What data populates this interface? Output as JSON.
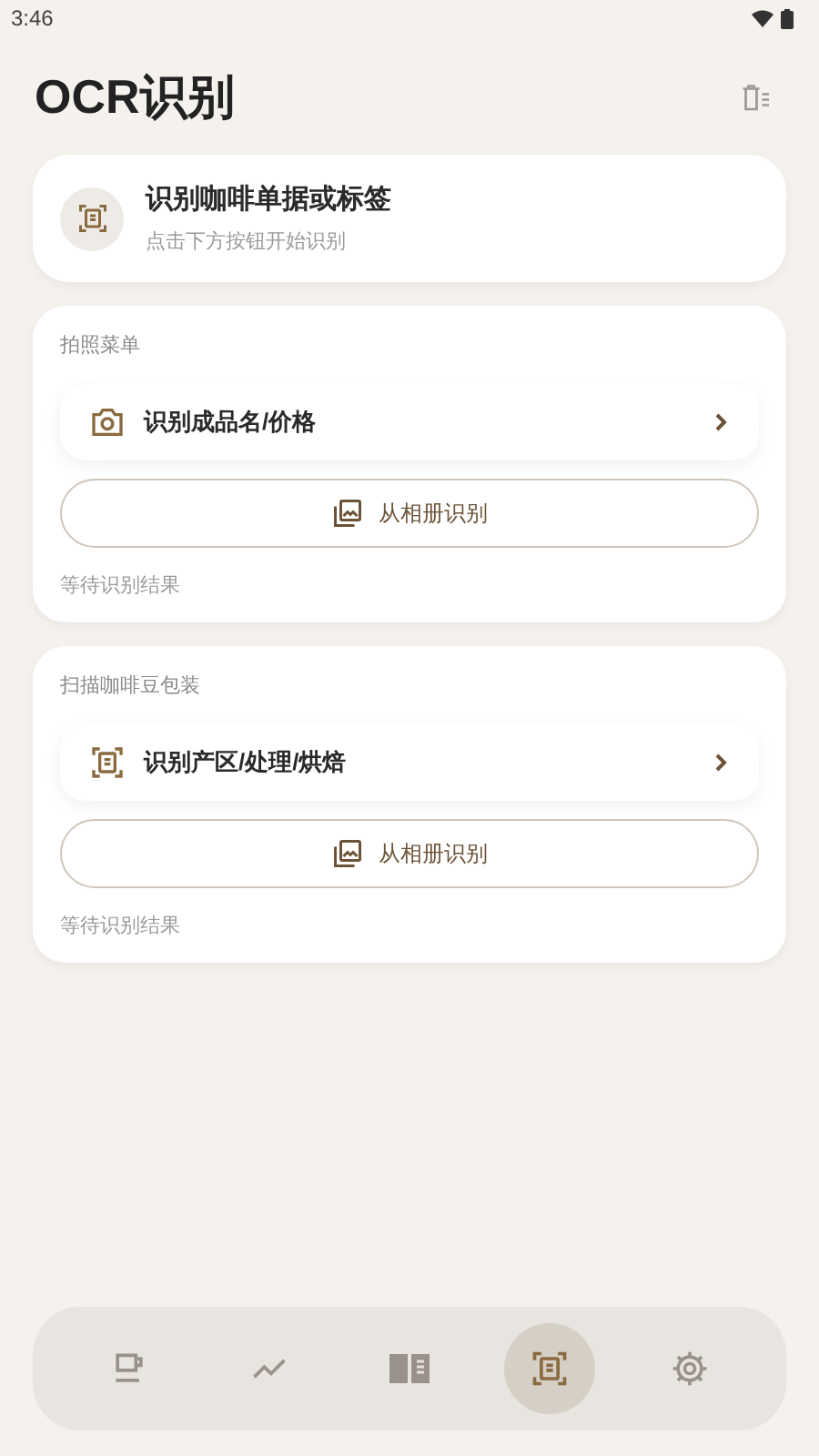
{
  "status_bar": {
    "time": "3:46"
  },
  "header": {
    "title": "OCR识别"
  },
  "intro": {
    "title": "识别咖啡单据或标签",
    "subtitle": "点击下方按钮开始识别"
  },
  "sections": [
    {
      "title": "拍照菜单",
      "action": {
        "kind": "camera",
        "label": "识别成品名/价格"
      },
      "album_button": "从相册识别",
      "result": "等待识别结果"
    },
    {
      "title": "扫描咖啡豆包装",
      "action": {
        "kind": "scan",
        "label": "识别产区/处理/烘焙"
      },
      "album_button": "从相册识别",
      "result": "等待识别结果"
    }
  ],
  "nav": [
    {
      "kind": "cup",
      "selected": false
    },
    {
      "kind": "trend",
      "selected": false
    },
    {
      "kind": "book",
      "selected": false
    },
    {
      "kind": "scan",
      "selected": true
    },
    {
      "kind": "gear",
      "selected": false
    }
  ]
}
